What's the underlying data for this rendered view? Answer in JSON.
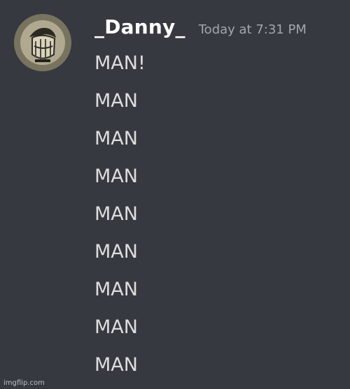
{
  "message": {
    "author": "_Danny_",
    "timestamp": "Today at 7:31 PM",
    "lines": [
      "MAN!",
      "MAN",
      "MAN",
      "MAN",
      "MAN",
      "MAN",
      "MAN",
      "MAN",
      "MAN"
    ]
  },
  "avatar": {
    "icon": "user-avatar-sketch",
    "background_color": "#7a7567"
  },
  "watermark": "imgflip.com",
  "colors": {
    "background": "#36393f",
    "username": "#ffffff",
    "timestamp": "#a3a6aa",
    "message_text": "#dcddde"
  }
}
